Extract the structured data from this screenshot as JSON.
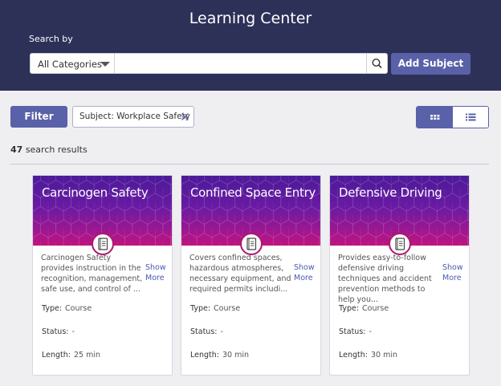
{
  "header": {
    "title": "Learning Center",
    "search_label": "Search by",
    "category": "All Categories",
    "search_placeholder": "",
    "add_subject": "Add Subject"
  },
  "toolbar": {
    "filter": "Filter",
    "chip": "Subject: Workplace Safety",
    "view_mode": "grid"
  },
  "results": {
    "count": "47",
    "label": "search results"
  },
  "cards": [
    {
      "title": "Carcinogen Safety",
      "description": "Carcinogen Safety provides instruction in the recognition, management, safe use, and control of ...",
      "show_more": "Show More",
      "type_label": "Type:",
      "type": "Course",
      "status_label": "Status:",
      "status": "-",
      "length_label": "Length:",
      "length": "25 min"
    },
    {
      "title": "Confined Space Entry",
      "description": "Covers confined spaces, hazardous atmospheres, necessary equipment, and required permits includi...",
      "show_more": "Show More",
      "type_label": "Type:",
      "type": "Course",
      "status_label": "Status:",
      "status": "-",
      "length_label": "Length:",
      "length": "30 min"
    },
    {
      "title": "Defensive Driving",
      "description": "Provides easy-to-follow defensive driving techniques and accident prevention methods to help you...",
      "show_more": "Show More",
      "type_label": "Type:",
      "type": "Course",
      "status_label": "Status:",
      "status": "-",
      "length_label": "Length:",
      "length": "30 min"
    }
  ],
  "colors": {
    "header_bg": "#2d3158",
    "accent": "#5961a8",
    "banner_top": "#4b1a99",
    "banner_bottom": "#c0137e"
  },
  "icons": [
    "chevron-down-icon",
    "search-icon",
    "close-icon",
    "grid-view-icon",
    "list-view-icon",
    "notebook-icon"
  ]
}
